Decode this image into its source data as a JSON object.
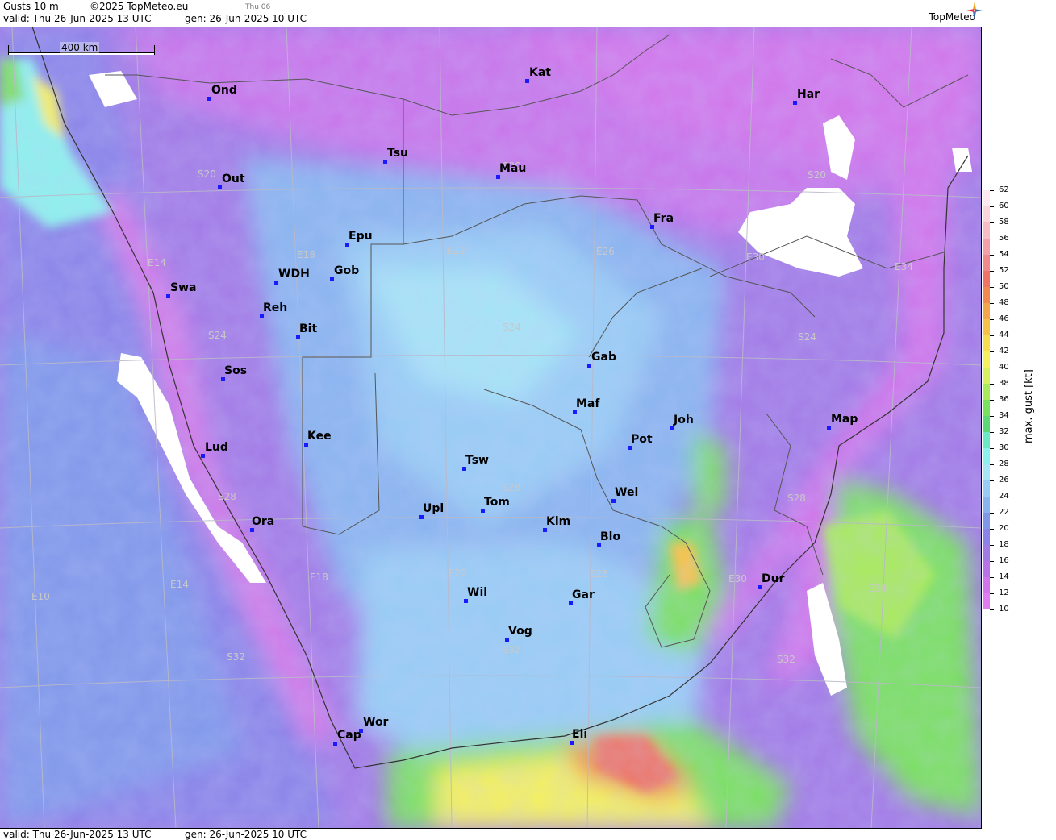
{
  "header": {
    "product": "Gusts 10 m",
    "copyright": "©2025 TopMeteo.eu",
    "day_tag": "Thu 06",
    "valid": "valid:  Thu  26-Jun-2025  13 UTC",
    "gen": "gen: 26-Jun-2025 10 UTC",
    "logo": "TopMeteo"
  },
  "footer": {
    "valid": "valid:  Thu  26-Jun-2025  13 UTC",
    "gen": "gen: 26-Jun-2025 10 UTC"
  },
  "map": {
    "scale_label": "400 km",
    "cities": [
      {
        "name": "Ond"
      },
      {
        "name": "Kat"
      },
      {
        "name": "Har"
      },
      {
        "name": "Tsu"
      },
      {
        "name": "Mau"
      },
      {
        "name": "Out"
      },
      {
        "name": "Fra"
      },
      {
        "name": "Epu"
      },
      {
        "name": "WDH"
      },
      {
        "name": "Gob"
      },
      {
        "name": "Swa"
      },
      {
        "name": "Reh"
      },
      {
        "name": "Bit"
      },
      {
        "name": "Gab"
      },
      {
        "name": "Sos"
      },
      {
        "name": "Maf"
      },
      {
        "name": "Joh"
      },
      {
        "name": "Map"
      },
      {
        "name": "Lud"
      },
      {
        "name": "Kee"
      },
      {
        "name": "Pot"
      },
      {
        "name": "Tsw"
      },
      {
        "name": "Wel"
      },
      {
        "name": "Tom"
      },
      {
        "name": "Upi"
      },
      {
        "name": "Kim"
      },
      {
        "name": "Ora"
      },
      {
        "name": "Blo"
      },
      {
        "name": "Dur"
      },
      {
        "name": "Wil"
      },
      {
        "name": "Gar"
      },
      {
        "name": "Vog"
      },
      {
        "name": "Wor"
      },
      {
        "name": "Cap"
      },
      {
        "name": "Eli"
      }
    ],
    "grid_labels": [
      "S20",
      "S20",
      "S20",
      "E14",
      "E18",
      "E22",
      "E26",
      "E30",
      "E34",
      "S24",
      "S24",
      "S24",
      "S28",
      "S28",
      "S28",
      "E10",
      "E14",
      "E18",
      "E22",
      "E26",
      "E30",
      "E34",
      "S32",
      "S32",
      "S32"
    ]
  },
  "legend": {
    "title": "max. gust [kt]",
    "ticks": [
      "62",
      "60",
      "58",
      "56",
      "54",
      "52",
      "50",
      "48",
      "46",
      "44",
      "42",
      "40",
      "38",
      "36",
      "34",
      "32",
      "30",
      "28",
      "26",
      "24",
      "22",
      "20",
      "18",
      "16",
      "14",
      "12",
      "10"
    ],
    "colors": [
      "#fde8f0",
      "#fbd5dc",
      "#f8bcc4",
      "#f4a0a8",
      "#f08a8c",
      "#ee7468",
      "#f08a50",
      "#f4a64a",
      "#f6c248",
      "#f8de4e",
      "#f4f060",
      "#d6f060",
      "#a8ea5c",
      "#7ae060",
      "#5cd874",
      "#6ce8c8",
      "#8ef0ec",
      "#a6e4f6",
      "#98ccf4",
      "#8ab4ef",
      "#8098ea",
      "#8a84e8",
      "#a27ae6",
      "#ba72e8",
      "#d274ea",
      "#e07cf0"
    ]
  }
}
